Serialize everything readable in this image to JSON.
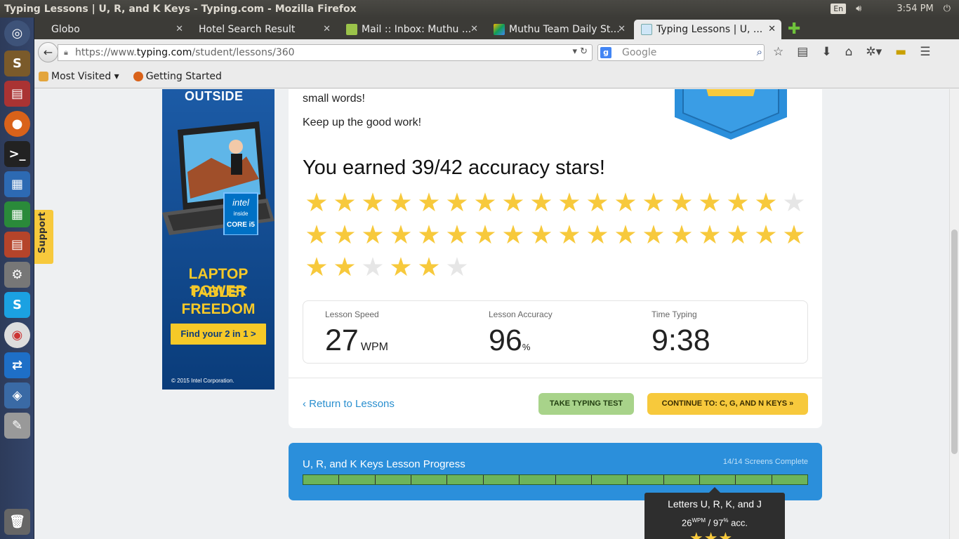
{
  "system": {
    "window_title": "Typing Lessons | U, R, and K Keys - Typing.com - Mozilla Firefox",
    "keyboard": "En",
    "clock": "3:54 PM"
  },
  "tabs": [
    {
      "label": "Globo"
    },
    {
      "label": "Hotel Search Result"
    },
    {
      "label": "Mail :: Inbox: Muthu ..."
    },
    {
      "label": "Muthu Team Daily St..."
    },
    {
      "label": "Typing Lessons | U, ..."
    }
  ],
  "url": {
    "prefix": "https://www.",
    "domain": "typing.com",
    "path": "/student/lessons/360"
  },
  "search": {
    "placeholder": "Google"
  },
  "bookmarks": {
    "most_visited": "Most Visited ▾",
    "getting_started": "Getting Started"
  },
  "support_label": "Support",
  "ad": {
    "top_text": "OUTSIDE",
    "chip_brand": "intel",
    "chip_inside": "inside",
    "chip_model": "CORE i5",
    "line1": "LAPTOP POWER",
    "line2": "TABLET FREEDOM",
    "button": "Find your 2 in 1 >",
    "copyright": "© 2015 Intel Corporation."
  },
  "result": {
    "line1": "small words!",
    "line2": "Keep up the good work!",
    "earned": "You earned 39/42 accuracy stars!",
    "stars_earned": 39,
    "stars_total": 42,
    "star_pattern": [
      1,
      1,
      1,
      1,
      1,
      1,
      1,
      1,
      1,
      1,
      1,
      1,
      1,
      1,
      1,
      1,
      1,
      0,
      1,
      1,
      1,
      1,
      1,
      1,
      1,
      1,
      1,
      1,
      1,
      1,
      1,
      1,
      1,
      1,
      1,
      1,
      1,
      1,
      0,
      1,
      1,
      0
    ]
  },
  "stats": {
    "speed_label": "Lesson Speed",
    "speed_value": "27",
    "speed_unit": "WPM",
    "accuracy_label": "Lesson Accuracy",
    "accuracy_value": "96",
    "accuracy_unit": "%",
    "time_label": "Time Typing",
    "time_value": "9:38"
  },
  "actions": {
    "return": "‹ Return to Lessons",
    "test": "TAKE TYPING TEST",
    "continue": "CONTINUE TO: C, G, AND N KEYS »"
  },
  "progress": {
    "title": "U, R, and K Keys Lesson Progress",
    "count": "14/14 Screens Complete",
    "screens_complete": 14,
    "screens_total": 14
  },
  "tooltip": {
    "title": "Letters U, R, K, and J",
    "wpm_value": "26",
    "wpm_unit": "WPM",
    "separator": " / ",
    "acc_value": "97",
    "acc_unit": "%",
    "acc_suffix": " acc."
  },
  "colors": {
    "accent_blue": "#2b8fdb",
    "star_yellow": "#f7c93c",
    "progress_green": "#6cb45a"
  }
}
